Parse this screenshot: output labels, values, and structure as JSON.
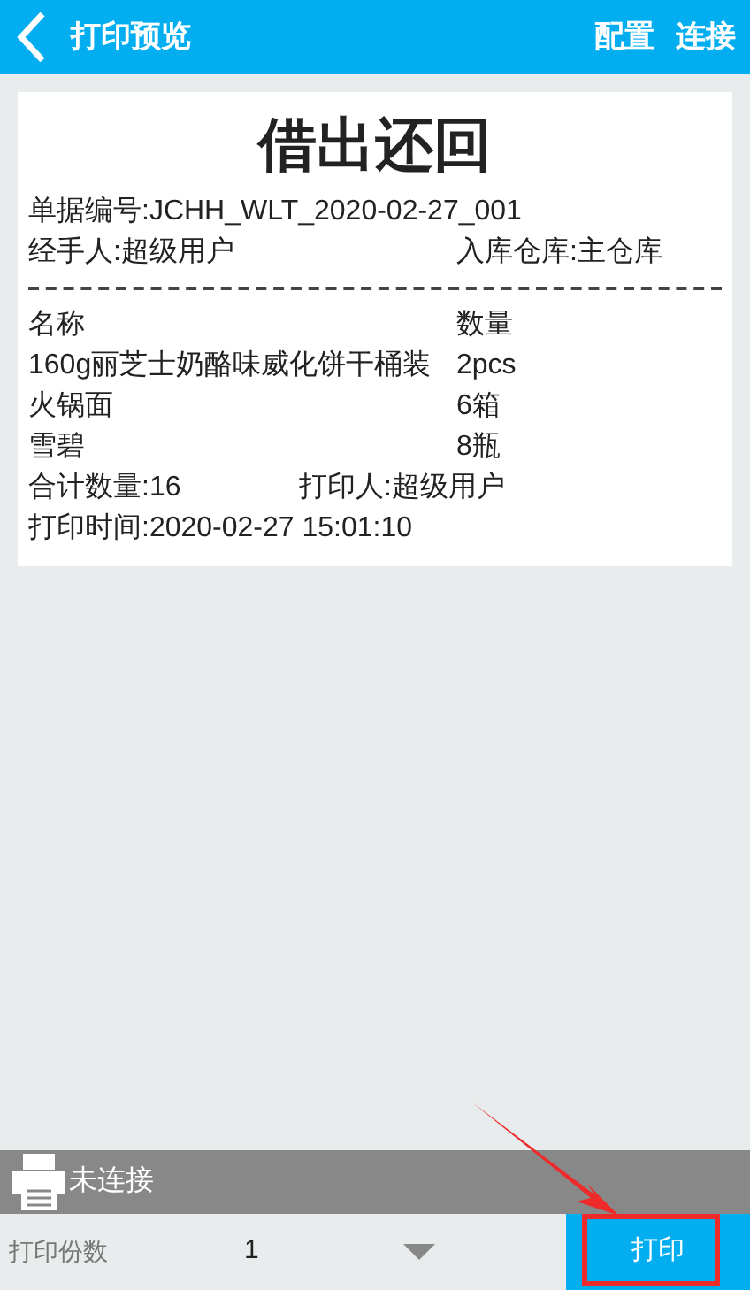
{
  "header": {
    "title": "打印预览",
    "actions": [
      "配置",
      "连接"
    ]
  },
  "receipt": {
    "title": "借出还回",
    "doc_no": "单据编号:JCHH_WLT_2020-02-27_001",
    "handler": "经手人:超级用户",
    "warehouse": "入库仓库:主仓库",
    "columns": [
      "名称",
      "数量"
    ],
    "rows": [
      {
        "name": "160g丽芝士奶酪味威化饼干桶装",
        "qty": "2pcs"
      },
      {
        "name": "火锅面",
        "qty": "6箱"
      },
      {
        "name": "雪碧",
        "qty": "8瓶"
      }
    ],
    "total": "合计数量:16",
    "printer": "打印人:超级用户",
    "time": "打印时间:2020-02-27 15:01:10"
  },
  "status_bar": {
    "text": "未连接"
  },
  "footer": {
    "label": "打印份数",
    "copies": "1",
    "print_button": "打印"
  }
}
